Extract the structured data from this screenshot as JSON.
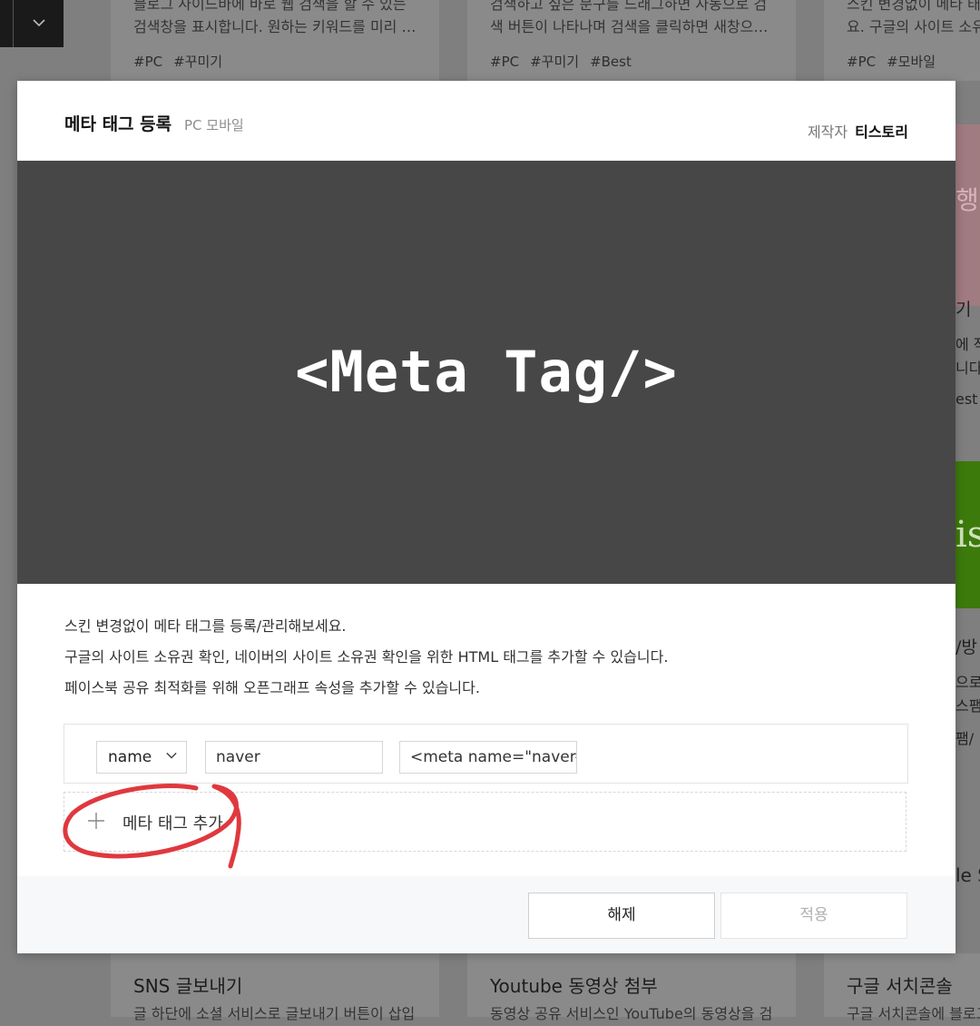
{
  "background": {
    "cards": [
      {
        "text": "블로그 사이드바에 바로 웹 검색을 할 수 있는",
        "text2": "검색창을 표시합니다. 원하는 키워드를 미리 …",
        "tags": [
          "#PC",
          "#꾸미기"
        ]
      },
      {
        "text": "검색하고 싶은 문구를 드래그하면 자동으로 검",
        "text2": "색 버튼이 나타나며 검색을 클릭하면 새창으…",
        "tags": [
          "#PC",
          "#꾸미기",
          "#Best"
        ]
      },
      {
        "text": "스킨 변경없이 메타 태그",
        "text2": "요. 구글의 사이트 소유",
        "tags": [
          "#PC",
          "#모바일"
        ]
      }
    ],
    "bottom_titles": [
      "SNS 글보내기",
      "Youtube 동영상 첨부",
      "구글 서치콘솔"
    ],
    "bottom_subs": [
      "글 하단에 소셜 서비스로 글보내기 버튼이 삽입",
      "동영상 공유 서비스인 YouTube의 동영상을 검",
      "구글 서치콘솔에 블로그"
    ],
    "side_snippets": [
      "행",
      "기",
      "에 작",
      "니다",
      "est",
      "is",
      "/방",
      "으로",
      "스팸",
      "팸/",
      "le S"
    ]
  },
  "modal": {
    "title": "메타 태그 등록",
    "platforms": "PC 모바일",
    "maker_label": "제작자",
    "maker_name": "티스토리",
    "hero_text": "<Meta Tag/>",
    "description": [
      "스킨 변경없이 메타 태그를 등록/관리해보세요.",
      "구글의 사이트 소유권 확인, 네이버의 사이트 소유권 확인을 위한 HTML 태그를 추가할 수 있습니다.",
      "페이스북 공유 최적화를 위해 오픈그래프 속성을 추가할 수 있습니다."
    ],
    "meta_row": {
      "attribute_select": "name",
      "name_value": "naver",
      "content_value": "<meta name=\"naver-si"
    },
    "add_label": "메타 태그 추가",
    "buttons": {
      "cancel": "해제",
      "apply": "적용"
    },
    "annotation_color": "#e0383e"
  }
}
